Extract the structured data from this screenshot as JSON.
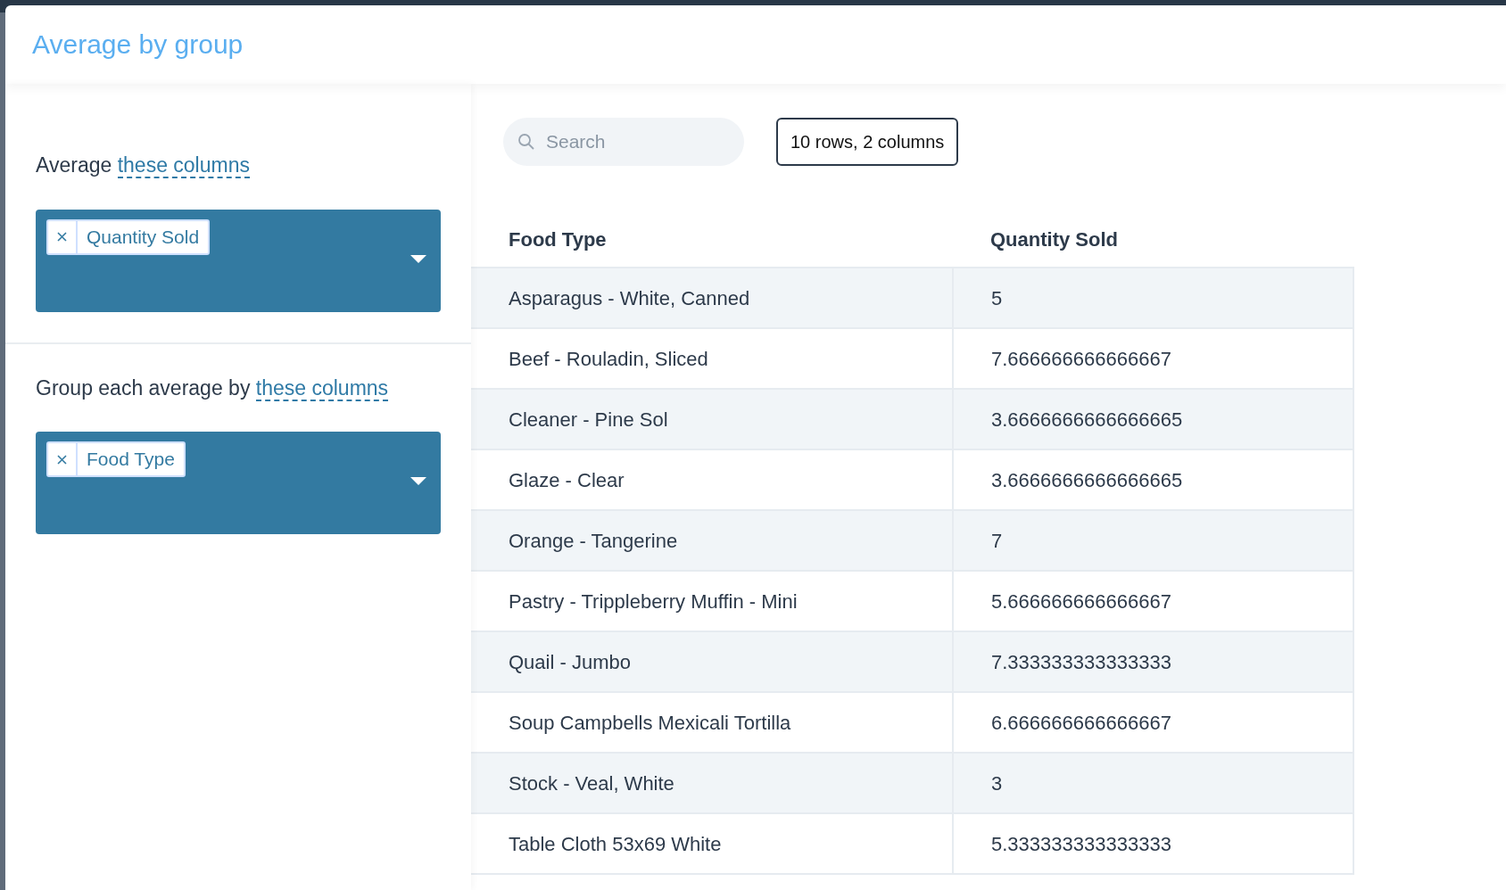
{
  "header": {
    "title": "Average by group"
  },
  "sections": [
    {
      "label": "Average",
      "link": "these columns",
      "tags": [
        "Quantity Sold"
      ]
    },
    {
      "label": "Group each average by",
      "link": "these columns",
      "tags": [
        "Food Type"
      ]
    }
  ],
  "search": {
    "placeholder": "Search"
  },
  "summary": "10 rows, 2 columns",
  "table": {
    "columns": [
      "Food Type",
      "Quantity Sold"
    ],
    "rows": [
      [
        "Asparagus - White, Canned",
        "5"
      ],
      [
        "Beef - Rouladin, Sliced",
        "7.666666666666667"
      ],
      [
        "Cleaner - Pine Sol",
        "3.6666666666666665"
      ],
      [
        "Glaze - Clear",
        "3.6666666666666665"
      ],
      [
        "Orange - Tangerine",
        "7"
      ],
      [
        "Pastry - Trippleberry Muffin - Mini",
        "5.666666666666667"
      ],
      [
        "Quail - Jumbo",
        "7.333333333333333"
      ],
      [
        "Soup Campbells Mexicali Tortilla",
        "6.666666666666667"
      ],
      [
        "Stock - Veal, White",
        "3"
      ],
      [
        "Table Cloth 53x69 White",
        "5.333333333333333"
      ]
    ]
  }
}
